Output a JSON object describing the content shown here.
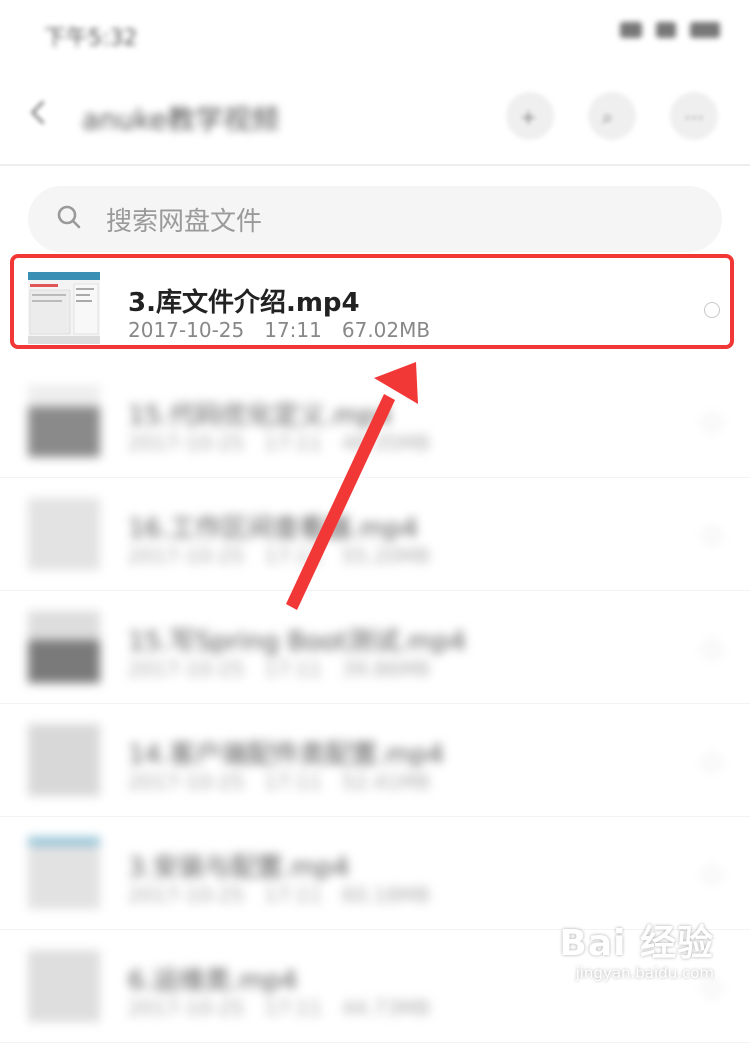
{
  "status_bar": {
    "time": "下午5:32"
  },
  "header": {
    "folder_title": "anuke教学视频",
    "icons": [
      "add-icon",
      "search-icon",
      "more-icon"
    ]
  },
  "search": {
    "placeholder": "搜索网盘文件"
  },
  "files": [
    {
      "name": "3.库文件介绍.mp4",
      "date": "2017-10-25",
      "time": "17:11",
      "size": "67.02MB",
      "selected": true
    },
    {
      "name": "15.代码优化定义.mp4",
      "date": "2017-10-25",
      "time": "17:11",
      "size": "48.35MB",
      "selected": false
    },
    {
      "name": "16.工作区间查看器.mp4",
      "date": "2017-10-25",
      "time": "17:11",
      "size": "55.20MB",
      "selected": false
    },
    {
      "name": "15.写Spring Boot测试.mp4",
      "date": "2017-10-25",
      "time": "17:11",
      "size": "39.86MB",
      "selected": false
    },
    {
      "name": "14.客户端配件类配置.mp4",
      "date": "2017-10-25",
      "time": "17:11",
      "size": "52.41MB",
      "selected": false
    },
    {
      "name": "3.安装与配置.mp4",
      "date": "2017-10-25",
      "time": "17:11",
      "size": "60.18MB",
      "selected": false
    },
    {
      "name": "6.运维类.mp4",
      "date": "2017-10-25",
      "time": "17:11",
      "size": "44.73MB",
      "selected": false
    }
  ],
  "colors": {
    "highlight": "#f23737",
    "arrow": "#f23737"
  },
  "watermark": {
    "brand": "Bai 经验",
    "site": "jingyan.baidu.com"
  }
}
